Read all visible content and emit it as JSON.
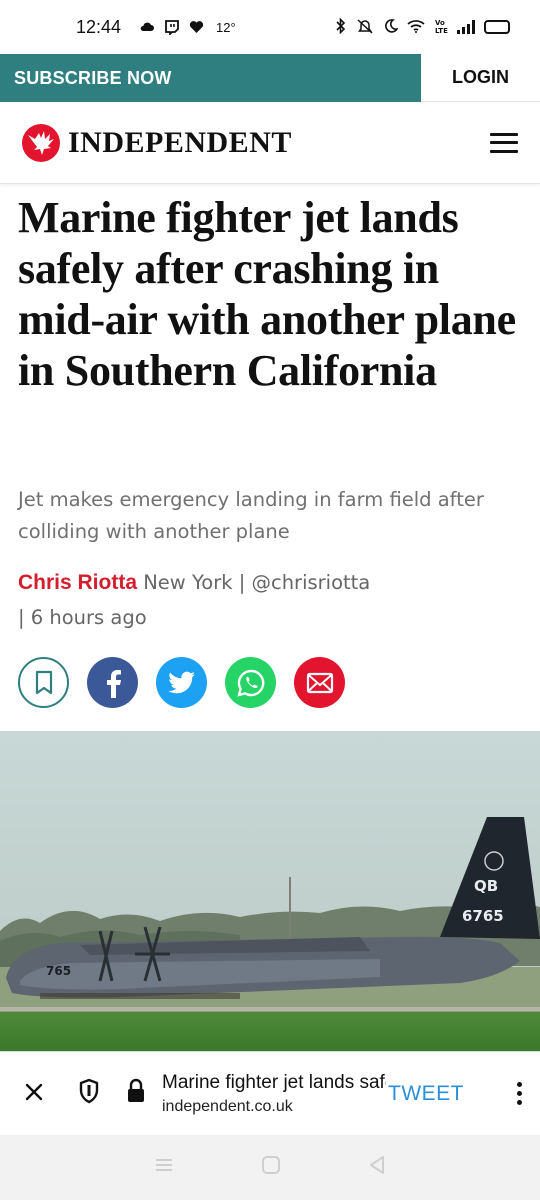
{
  "status_bar": {
    "time": "12:44",
    "temperature": "12°",
    "battery_level": 1.0
  },
  "top_bar": {
    "subscribe_label": "SUBSCRIBE NOW",
    "login_label": "LOGIN",
    "accent_color": "#2f7f80"
  },
  "masthead": {
    "logo_text": "INDEPENDENT",
    "logo_icon": "eagle-icon",
    "menu_icon": "hamburger-menu-icon",
    "brand_color": "#e3142d"
  },
  "article": {
    "headline": "Marine fighter jet lands safely after crashing in mid-air with another plane in Southern California",
    "standfirst": "Jet makes emergency landing in farm field after colliding with another plane",
    "author": "Chris Riotta",
    "location": "New York | @chrisriotta",
    "published": "| 6 hours ago",
    "hero_tail_markings": [
      "QB",
      "6765"
    ],
    "hero_fuselage_marking": "765"
  },
  "share": {
    "buttons": [
      "bookmark-icon",
      "facebook-icon",
      "twitter-icon",
      "whatsapp-icon",
      "email-icon"
    ]
  },
  "browser_bar": {
    "page_title": "Marine fighter jet lands safely after crashing in mid-air",
    "domain": "independent.co.uk",
    "tweet_label": "TWEET",
    "tweet_color": "#2b90d9"
  }
}
